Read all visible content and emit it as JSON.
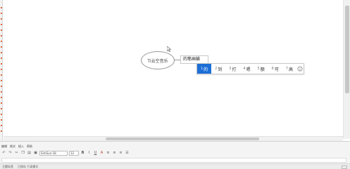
{
  "canvas": {
    "node_text": "Ti云空音乐",
    "edit_text": "的笔画输"
  },
  "ime": {
    "candidates": [
      {
        "num": "1",
        "text": "的"
      },
      {
        "num": "2",
        "text": "到"
      },
      {
        "num": "3",
        "text": "打"
      },
      {
        "num": "4",
        "text": "嗯"
      },
      {
        "num": "5",
        "text": "额"
      },
      {
        "num": "6",
        "text": "可"
      },
      {
        "num": "7",
        "text": "高"
      }
    ],
    "emoji_icon": "smile-icon",
    "active_index": 0,
    "accent_color": "#1c6fd6"
  },
  "menu": [
    "编辑",
    "格式",
    "插入",
    "帮助"
  ],
  "toolbar": {
    "font_value": "SimSun-18",
    "size_value": "12",
    "icons": [
      "undo-icon",
      "redo-icon",
      "cut-icon",
      "copy-icon",
      "paste-icon",
      "image-icon",
      "bold-icon",
      "italic-icon",
      "underline-icon",
      "color-icon",
      "align-left-icon",
      "align-center-icon",
      "align-right-icon",
      "list-icon"
    ]
  },
  "status": {
    "left": "主题标签",
    "right": "已保存 只读模式"
  }
}
